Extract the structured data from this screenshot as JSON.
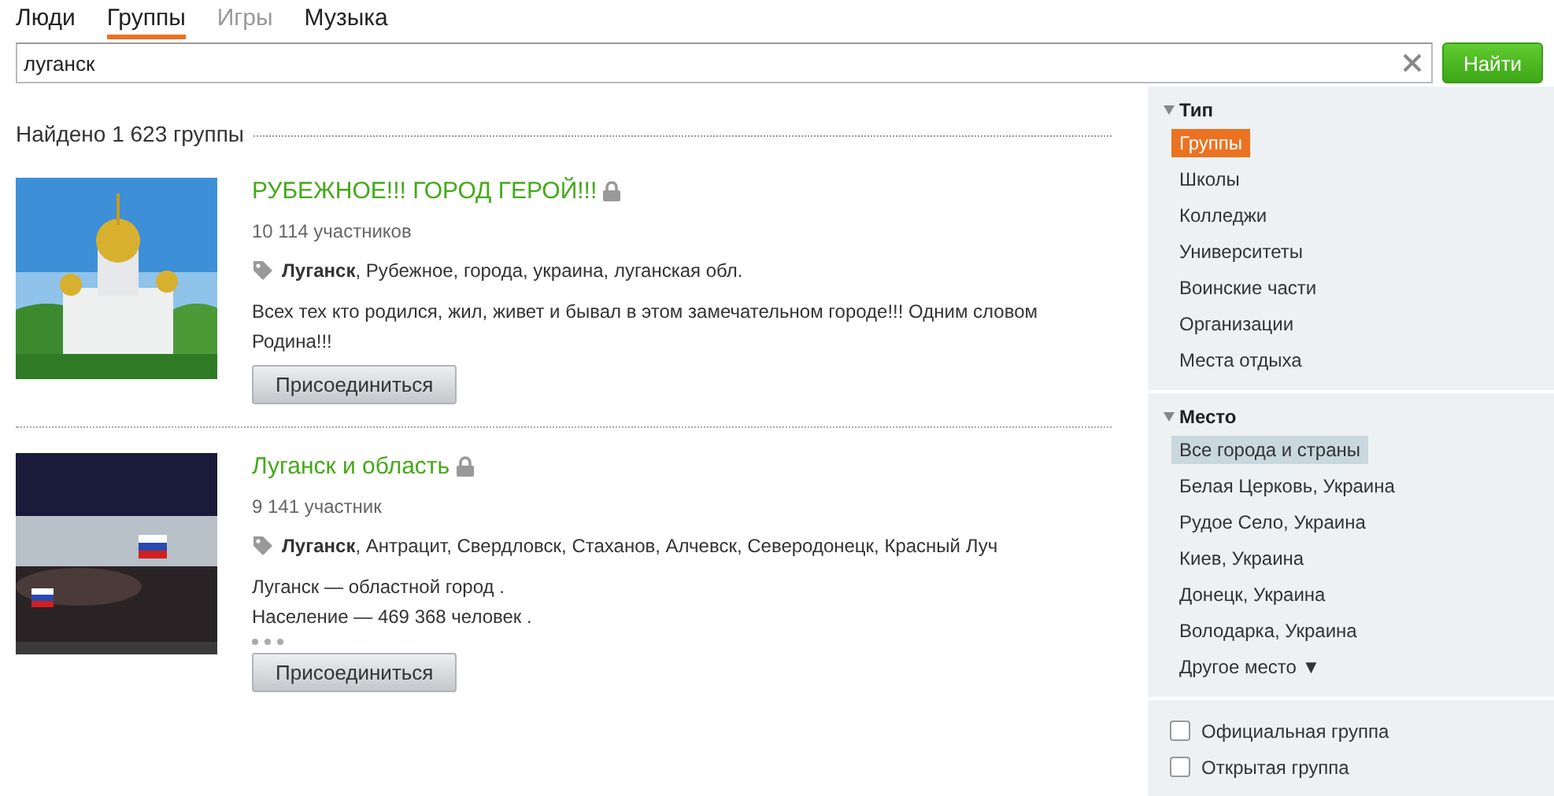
{
  "tabs": [
    {
      "label": "Люди",
      "selected": false,
      "disabled": false
    },
    {
      "label": "Группы",
      "selected": true,
      "disabled": false
    },
    {
      "label": "Игры",
      "selected": false,
      "disabled": true
    },
    {
      "label": "Музыка",
      "selected": false,
      "disabled": false
    }
  ],
  "search": {
    "value": "луганск",
    "button": "Найти"
  },
  "results_heading": "Найдено 1 623 группы",
  "groups": [
    {
      "kind": "church",
      "title": "РУБЕЖНОЕ!!! ГОРОД ГЕРОЙ!!!",
      "locked": true,
      "members": "10 114 участников",
      "tags": "**Луганск**, Рубежное, города, украина, луганская обл.",
      "description": [
        "Всех тех кто родился, жил, живет и бывал в этом замечательном городе!!! Одним словом Родина!!!"
      ],
      "truncated": false,
      "button": "Присоединиться"
    },
    {
      "kind": "crowd",
      "title": "Луганск и область",
      "locked": true,
      "members": "9 141 участник",
      "tags": "**Луганск**, Антрацит, Свердловск, Стаханов, Алчевск, Северодонецк, Красный Луч",
      "description": [
        "Луганск  — областной город .",
        "Население — 469 368 человек ."
      ],
      "truncated": true,
      "button": "Присоединиться"
    }
  ],
  "sidebar": {
    "sections": [
      {
        "title": "Тип",
        "expanded": true,
        "items": [
          {
            "label": "Группы",
            "selected": true
          },
          {
            "label": "Школы",
            "selected": false
          },
          {
            "label": "Колледжи",
            "selected": false
          },
          {
            "label": "Университеты",
            "selected": false
          },
          {
            "label": "Воинские части",
            "selected": false
          },
          {
            "label": "Организации",
            "selected": false
          },
          {
            "label": "Места отдыха",
            "selected": false
          }
        ]
      },
      {
        "title": "Место",
        "expanded": true,
        "items": [
          {
            "label": "Все города и страны",
            "selected": true
          },
          {
            "label": "Белая Церковь, Украина",
            "selected": false
          },
          {
            "label": "Рудое Село, Украина",
            "selected": false
          },
          {
            "label": "Киев, Украина",
            "selected": false
          },
          {
            "label": "Донецк, Украина",
            "selected": false
          },
          {
            "label": "Володарка, Украина",
            "selected": false
          }
        ],
        "more": "Другое место ▼"
      }
    ],
    "checkboxes": [
      {
        "label": "Официальная группа",
        "checked": false
      },
      {
        "label": "Открытая группа",
        "checked": false
      }
    ]
  }
}
